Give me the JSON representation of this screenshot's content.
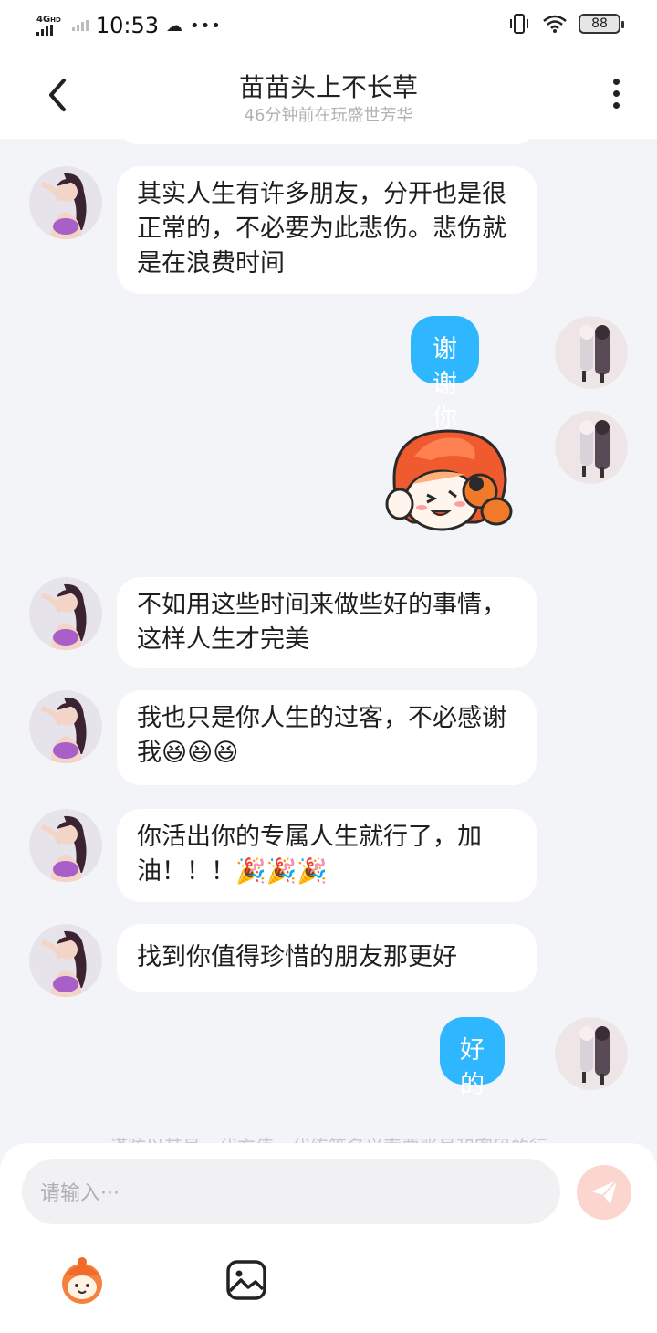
{
  "status_bar": {
    "network": "4G",
    "network_sup": "HD",
    "time": "10:53",
    "battery": "88"
  },
  "header": {
    "title": "苗苗头上不长草",
    "subtitle": "46分钟前在玩盛世芳华"
  },
  "messages": [
    {
      "from": "other",
      "text": "其实人生有许多朋友，分开也是很正常的，不必要为此悲伤。悲伤就是在浪费时间"
    },
    {
      "from": "me",
      "text": "谢谢你"
    },
    {
      "from": "me",
      "type": "sticker",
      "sticker": "mascot-hug-sticker"
    },
    {
      "from": "other",
      "text": "不如用这些时间来做些好的事情，这样人生才完美"
    },
    {
      "from": "other",
      "text": "我也只是你人生的过客，不必感谢我",
      "emojis": "😆😆😆"
    },
    {
      "from": "other",
      "text": "你活出你的专属人生就行了，加油！！！",
      "emojis": "🎉🎉🎉"
    },
    {
      "from": "other",
      "text": "找到你值得珍惜的朋友那更好"
    },
    {
      "from": "me",
      "text": "好的"
    }
  ],
  "notice": "谨防以其号、代充值、代练等名义索要账号和密码的行",
  "composer": {
    "placeholder": "请输入···",
    "send_icon": "send-icon",
    "tools": [
      "mascot-emoji-icon",
      "image-icon"
    ]
  },
  "colors": {
    "my_bubble": "#2eb6ff",
    "other_bubble": "#ffffff",
    "background": "#f3f4f8",
    "send_button": "#fbd6cf"
  }
}
